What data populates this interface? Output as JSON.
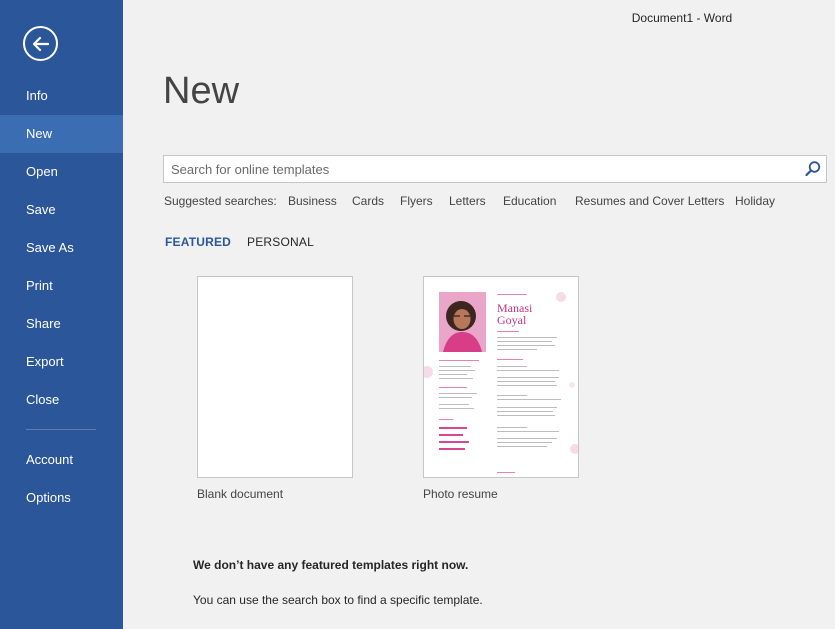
{
  "window": {
    "title": "Document1 - Word"
  },
  "sidebar": {
    "items": [
      {
        "label": "Info"
      },
      {
        "label": "New"
      },
      {
        "label": "Open"
      },
      {
        "label": "Save"
      },
      {
        "label": "Save As"
      },
      {
        "label": "Print"
      },
      {
        "label": "Share"
      },
      {
        "label": "Export"
      },
      {
        "label": "Close"
      },
      {
        "label": "Account"
      },
      {
        "label": "Options"
      }
    ],
    "active": "New"
  },
  "main": {
    "title": "New",
    "search": {
      "placeholder": "Search for online templates",
      "value": ""
    },
    "suggested": {
      "label": "Suggested searches:",
      "items": [
        "Business",
        "Cards",
        "Flyers",
        "Letters",
        "Education",
        "Resumes and Cover Letters",
        "Holiday"
      ]
    },
    "tabs": [
      {
        "label": "FEATURED",
        "selected": true
      },
      {
        "label": "PERSONAL",
        "selected": false
      }
    ],
    "templates": [
      {
        "label": "Blank document"
      },
      {
        "label": "Photo resume",
        "preview_name_first": "Manasi",
        "preview_name_last": "Goyal"
      }
    ],
    "empty_message": "We don’t have any featured templates right now.",
    "empty_hint": "You can use the search box to find a specific template."
  },
  "colors": {
    "sidebar": "#2b579a",
    "sidebar_active": "#3b6db2",
    "accent": "#2b579a",
    "resume_accent": "#c2347e"
  }
}
